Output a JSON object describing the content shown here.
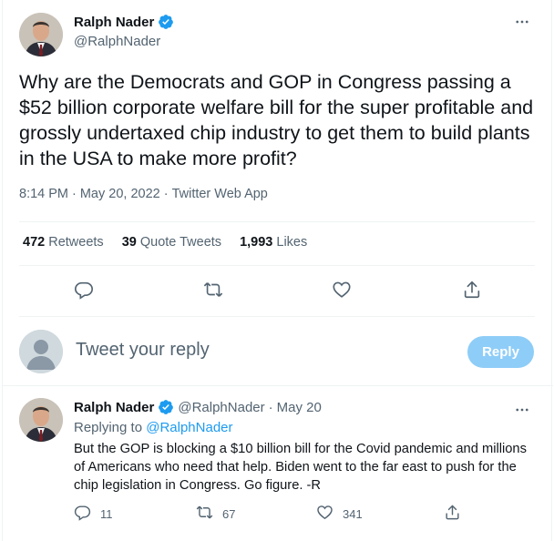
{
  "tweet": {
    "author_name": "Ralph Nader",
    "author_handle": "@RalphNader",
    "verified": true,
    "text": "Why are the Democrats and GOP in Congress passing a $52 billion corporate welfare bill for the super profitable and grossly undertaxed chip industry to get them to build plants in the USA to make more profit?",
    "time": "8:14 PM",
    "date": "May 20, 2022",
    "source": "Twitter Web App",
    "separator": "·"
  },
  "stats": {
    "retweets_count": "472",
    "retweets_label": "Retweets",
    "quotes_count": "39",
    "quotes_label": "Quote Tweets",
    "likes_count": "1,993",
    "likes_label": "Likes"
  },
  "actions": [
    "reply-icon",
    "retweet-icon",
    "like-icon",
    "share-icon"
  ],
  "compose": {
    "placeholder": "Tweet your reply",
    "button_label": "Reply"
  },
  "reply_tweet": {
    "author_name": "Ralph Nader",
    "author_handle": "@RalphNader",
    "separator": "·",
    "date": "May 20",
    "replying_label": "Replying to",
    "replying_handle": "@RalphNader",
    "text": "But the GOP is blocking a $10 billion bill for the Covid pandemic and millions of Americans who need that help. Biden went to the far east to push for the chip legislation in Congress. Go figure. -R",
    "replies_count": "11",
    "retweets_count": "67",
    "likes_count": "341"
  },
  "colors": {
    "accent": "#1d9bf0",
    "reply_button_disabled": "#8ecdf8",
    "secondary_text": "#536471",
    "divider": "#eff3f4"
  }
}
